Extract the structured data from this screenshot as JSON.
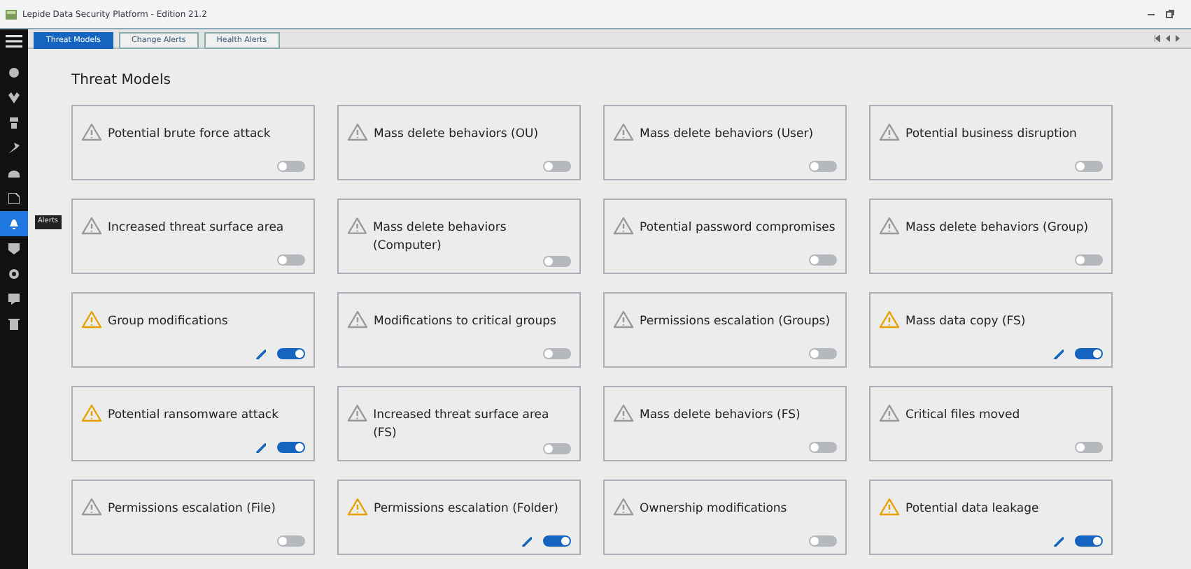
{
  "window": {
    "title": "Lepide Data Security Platform - Edition 21.2"
  },
  "tabs": [
    {
      "label": "Threat Models",
      "selected": true
    },
    {
      "label": "Change Alerts",
      "selected": false
    },
    {
      "label": "Health Alerts",
      "selected": false
    }
  ],
  "sidebar": {
    "items": [
      {
        "selected": false
      },
      {
        "selected": false
      },
      {
        "selected": false
      },
      {
        "selected": false
      },
      {
        "selected": false
      },
      {
        "selected": false
      },
      {
        "selected": true,
        "tooltip": "Alerts"
      },
      {
        "selected": false
      },
      {
        "selected": false
      },
      {
        "selected": false
      },
      {
        "selected": false
      }
    ]
  },
  "heading": "Threat Models",
  "models": [
    {
      "name": "Potential brute force attack",
      "enabled": false
    },
    {
      "name": "Mass delete behaviors (OU)",
      "enabled": false
    },
    {
      "name": "Mass delete behaviors (User)",
      "enabled": false
    },
    {
      "name": "Potential business disruption",
      "enabled": false
    },
    {
      "name": "Increased threat surface area",
      "enabled": false
    },
    {
      "name": "Mass delete behaviors (Computer)",
      "enabled": false
    },
    {
      "name": "Potential password compromises",
      "enabled": false
    },
    {
      "name": "Mass delete behaviors (Group)",
      "enabled": false
    },
    {
      "name": "Group modifications",
      "enabled": true
    },
    {
      "name": "Modifications to critical groups",
      "enabled": false
    },
    {
      "name": "Permissions escalation (Groups)",
      "enabled": false
    },
    {
      "name": "Mass data copy (FS)",
      "enabled": true
    },
    {
      "name": "Potential ransomware attack",
      "enabled": true
    },
    {
      "name": "Increased threat surface area (FS)",
      "enabled": false
    },
    {
      "name": "Mass delete behaviors (FS)",
      "enabled": false
    },
    {
      "name": "Critical files moved",
      "enabled": false
    },
    {
      "name": "Permissions escalation (File)",
      "enabled": false
    },
    {
      "name": "Permissions escalation (Folder)",
      "enabled": true
    },
    {
      "name": "Ownership modifications",
      "enabled": false
    },
    {
      "name": "Potential data leakage",
      "enabled": true
    }
  ]
}
